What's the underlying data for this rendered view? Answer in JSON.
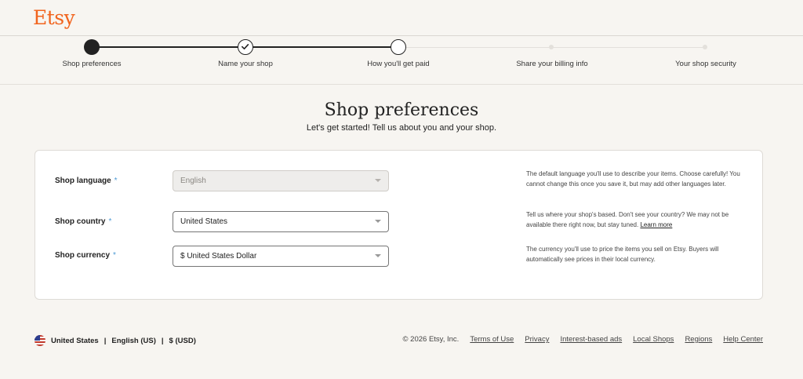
{
  "brand": {
    "name": "Etsy",
    "color": "#f1641e"
  },
  "steps": [
    {
      "label": "Shop preferences",
      "state": "current"
    },
    {
      "label": "Name your shop",
      "state": "complete"
    },
    {
      "label": "How you'll get paid",
      "state": "upcoming-next"
    },
    {
      "label": "Share your billing info",
      "state": "upcoming"
    },
    {
      "label": "Your shop security",
      "state": "upcoming"
    }
  ],
  "page": {
    "title": "Shop preferences",
    "subtitle": "Let's get started! Tell us about you and your shop."
  },
  "fields": [
    {
      "label": "Shop language",
      "required_mark": "*",
      "value": "English",
      "disabled": true,
      "help": "The default language you'll use to describe your items. Choose carefully! You cannot change this once you save it, but may add other languages later."
    },
    {
      "label": "Shop country",
      "required_mark": "*",
      "value": "United States",
      "disabled": false,
      "help": "Tell us where your shop's based. Don't see your country? We may not be available there right now, but stay tuned.",
      "help_link": "Learn more"
    },
    {
      "label": "Shop currency",
      "required_mark": "*",
      "value": "$ United States Dollar",
      "disabled": false,
      "help": "The currency you'll use to price the items you sell on Etsy. Buyers will automatically see prices in their local currency."
    }
  ],
  "footer": {
    "region": "United States",
    "language": "English (US)",
    "currency": "$ (USD)",
    "separator": "|",
    "copyright": "© 2026 Etsy, Inc.",
    "links": [
      "Terms of Use",
      "Privacy",
      "Interest-based ads",
      "Local Shops",
      "Regions",
      "Help Center"
    ]
  }
}
